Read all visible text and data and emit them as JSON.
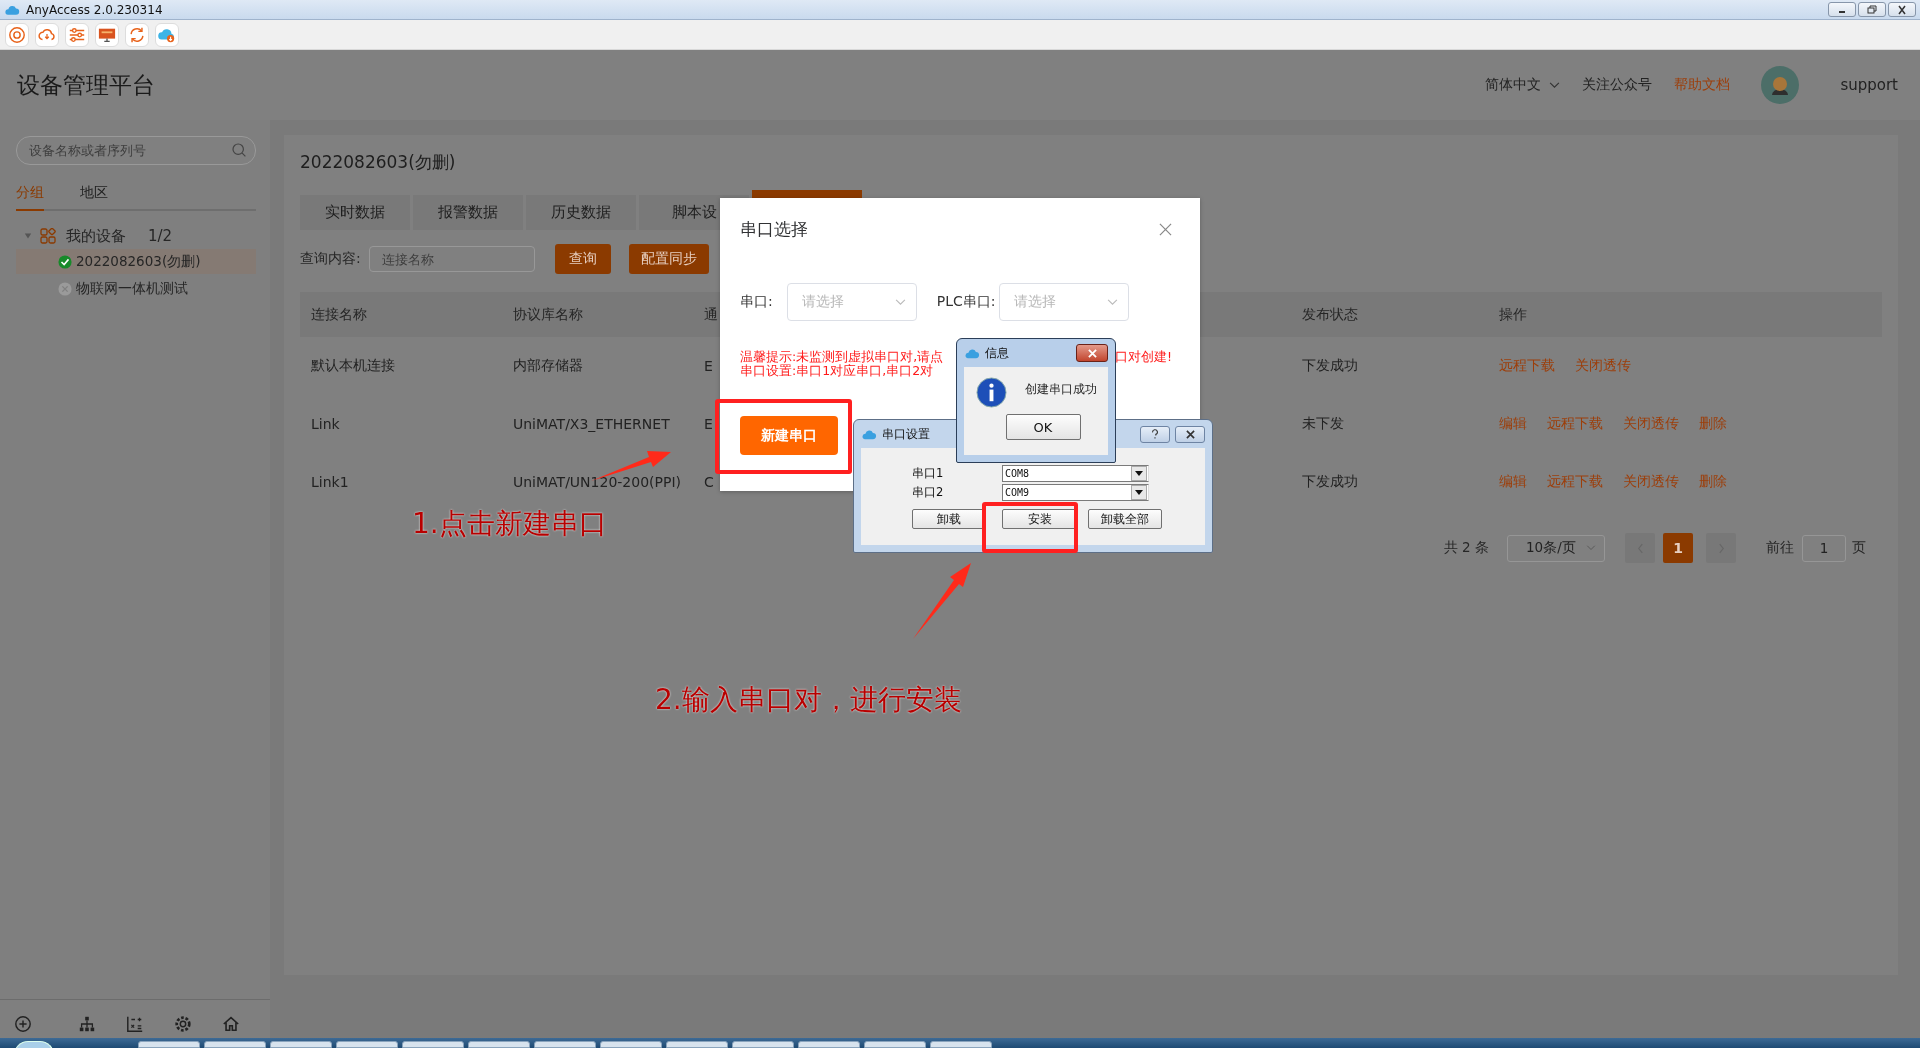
{
  "window": {
    "title": "AnyAccess 2.0.230314"
  },
  "header": {
    "title": "设备管理平台",
    "language": "简体中文",
    "follow": "关注公众号",
    "help": "帮助文档",
    "user": "support"
  },
  "sidebar": {
    "search": {
      "placeholder": "设备名称或者序列号"
    },
    "tabs": [
      {
        "label": "分组",
        "selected": true
      },
      {
        "label": "地区",
        "selected": false
      }
    ],
    "tree": [
      {
        "label": "我的设备",
        "count": "1/2",
        "expanded": true,
        "children": [
          {
            "label": "2022082603(勿删)",
            "online": true,
            "selected": true
          },
          {
            "label": "物联网一体机测试",
            "online": false,
            "selected": false
          }
        ]
      }
    ]
  },
  "main": {
    "title": "2022082603(勿删)",
    "tabs": [
      {
        "label": "实时数据",
        "selected": false
      },
      {
        "label": "报警数据",
        "selected": false
      },
      {
        "label": "历史数据",
        "selected": false
      },
      {
        "label": "脚本设",
        "selected": false
      },
      {
        "selected": true
      }
    ],
    "query": {
      "label": "查询内容:",
      "placeholder": "连接名称",
      "buttons": [
        "查询",
        "配置同步"
      ]
    },
    "table": {
      "columns": [
        "连接名称",
        "协议库名称",
        "通",
        "发布状态",
        "操作"
      ],
      "rows": [
        {
          "cells": [
            "默认本机连接",
            "内部存储器",
            "E",
            "下发成功"
          ],
          "actions": [
            "远程下载",
            "关闭透传"
          ]
        },
        {
          "cells": [
            "Link",
            "UniMAT/X3_ETHERNET",
            "E",
            "未下发"
          ],
          "actions": [
            "编辑",
            "远程下载",
            "关闭透传",
            "删除"
          ]
        },
        {
          "cells": [
            "Link1",
            "UniMAT/UN120-200(PPI)",
            "C",
            "下发成功"
          ],
          "actions": [
            "编辑",
            "远程下载",
            "关闭透传",
            "删除"
          ]
        }
      ]
    },
    "pagination": {
      "total": "共 2 条",
      "page_size": "10条/页",
      "pages": [
        {
          "label": "1",
          "selected": true
        }
      ],
      "goto_label": "前往",
      "goto_value": "1",
      "goto_suffix": "页"
    }
  },
  "port_dialog": {
    "title": "串口选择",
    "fields": [
      {
        "label": "串口:",
        "placeholder": "请选择"
      },
      {
        "label": "PLC串口:",
        "placeholder": "请选择"
      }
    ],
    "warning_lines": [
      {
        "left": "温馨提示:未监测到虚拟串口对,请点",
        "right": "口对创建!"
      },
      {
        "left": "串口设置:串口1对应串口,串口2对"
      }
    ],
    "button": "新建串口"
  },
  "serial_dialog": {
    "title": "串口设置",
    "rows": [
      {
        "label": "串口1",
        "value": "COM8"
      },
      {
        "label": "串口2",
        "value": "COM9"
      }
    ],
    "buttons": [
      "卸载",
      "安装",
      "卸载全部"
    ]
  },
  "info_dialog": {
    "title": "信息",
    "message": "创建串口成功",
    "button": "OK"
  },
  "annotations": [
    {
      "text": "1.点击新建串口"
    },
    {
      "text": "2.输入串口对，进行安装"
    }
  ]
}
